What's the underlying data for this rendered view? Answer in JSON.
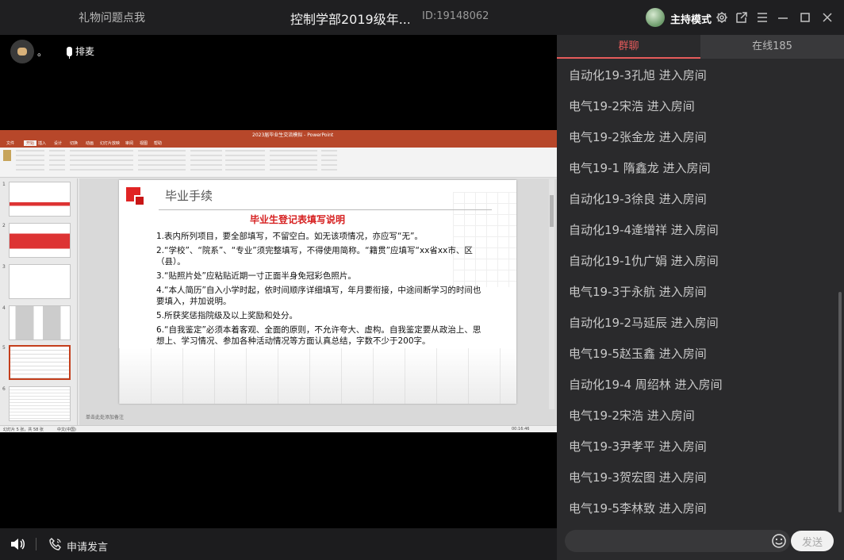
{
  "titlebar": {
    "left_link": "礼物问题点我",
    "room_title": "控制学部2019级年...",
    "room_id": "ID:19148062",
    "host_mode": "主持模式"
  },
  "stage": {
    "dot_label": "。",
    "queue_label": "排麦"
  },
  "slide": {
    "heading": "毕业手续",
    "subtitle": "毕业生登记表填写说明",
    "lines": [
      "1.表内所列项目，要全部填写，不留空白。如无该项情况，亦应写“无”。",
      "2.“学校”、“院系”、“专业”须完整填写，不得使用简称。“籍贯”应填写“xx省xx市、区（县）。",
      "3.“贴照片处”应粘贴近期一寸正面半身免冠彩色照片。",
      "4.“本人简历”自入小学时起，依时间顺序详细填写，年月要衔接，中途间断学习的时间也要填入，并加说明。",
      "5.所获奖惩指院级及以上奖励和处分。",
      "6.“自我鉴定”必须本着客观、全面的原则，不允许夸大、虚构。自我鉴定要从政治上、思想上、学习情况、参加各种活动情况等方面认真总结，字数不少于200字。"
    ]
  },
  "ppt": {
    "window_title": "2023届毕业生交流模拟 - PowerPoint",
    "tabs": [
      "文件",
      "开始",
      "插入",
      "设计",
      "切换",
      "动画",
      "幻灯片放映",
      "审阅",
      "视图",
      "帮助"
    ],
    "notes_hint": "单击此处添加备注",
    "status_left": "幻灯片 5 张，共 58 张",
    "status_lang": "中文(中国)",
    "status_time": "00:16:46",
    "thumb_numbers": [
      "1",
      "2",
      "3",
      "4",
      "5",
      "6"
    ]
  },
  "bottombar": {
    "apply_speak": "申请发言"
  },
  "panel": {
    "tabs": [
      "群聊",
      "在线185"
    ],
    "messages": [
      "自动化19-3孔旭 进入房间",
      "电气19-2宋浩 进入房间",
      "电气19-2张金龙 进入房间",
      "电气19-1 隋鑫龙 进入房间",
      "自动化19-3徐良 进入房间",
      "自动化19-4逄增祥 进入房间",
      "自动化19-1仇广娟 进入房间",
      "电气19-3于永航 进入房间",
      "自动化19-2马延辰 进入房间",
      "电气19-5赵玉鑫 进入房间",
      "自动化19-4 周绍林 进入房间",
      "电气19-2宋浩 进入房间",
      "电气19-3尹孝平 进入房间",
      "电气19-3贺宏图 进入房间",
      "电气19-5李林致 进入房间"
    ],
    "send_label": "发送"
  },
  "colors": {
    "accent": "#e65b5b",
    "ppt_red": "#b7472a",
    "panel_bg": "#2a2a2c"
  }
}
